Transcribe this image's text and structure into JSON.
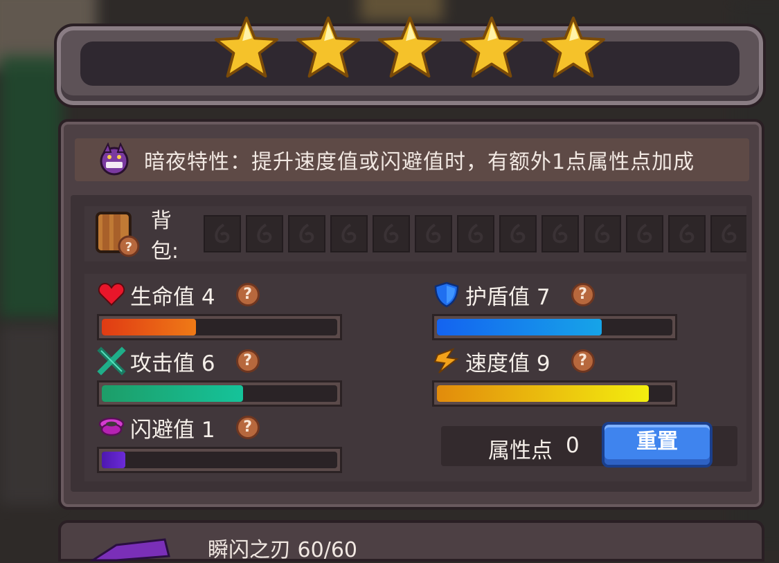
{
  "stars": {
    "count": 5,
    "filled": 5,
    "color": "#f5c22a"
  },
  "trait": {
    "icon": "purple-demon-face-icon",
    "text": "暗夜特性：提升速度值或闪避值时，有额外1点属性点加成"
  },
  "backpack": {
    "label": "背包:",
    "icon": "backpack-help-icon",
    "slot_count": 13,
    "slot_icon": "empty-slot-icon"
  },
  "stats": {
    "hp": {
      "label": "生命值 4",
      "value": 4,
      "max": 10,
      "icon": "heart-icon",
      "colors": [
        "#e03b14",
        "#ef7a16"
      ]
    },
    "shield": {
      "label": "护盾值 7",
      "value": 7,
      "max": 10,
      "icon": "shield-icon",
      "colors": [
        "#1463f0",
        "#16a4e8"
      ]
    },
    "attack": {
      "label": "攻击值 6",
      "value": 6,
      "max": 10,
      "icon": "crossed-swords-icon",
      "colors": [
        "#1d9d68",
        "#15c39a"
      ]
    },
    "speed": {
      "label": "速度值 9",
      "value": 9,
      "max": 10,
      "icon": "lightning-icon",
      "colors": [
        "#e28b0c",
        "#f3ee0f"
      ]
    },
    "dodge": {
      "label": "闪避值 1",
      "value": 1,
      "max": 10,
      "icon": "dodge-ring-icon",
      "colors": [
        "#4d18b0",
        "#6b2bd7"
      ]
    }
  },
  "points": {
    "label": "属性点",
    "value": "0",
    "reset_label": "重置"
  },
  "help_glyph": "?",
  "item": {
    "name": "瞬闪之刃  60/60"
  }
}
